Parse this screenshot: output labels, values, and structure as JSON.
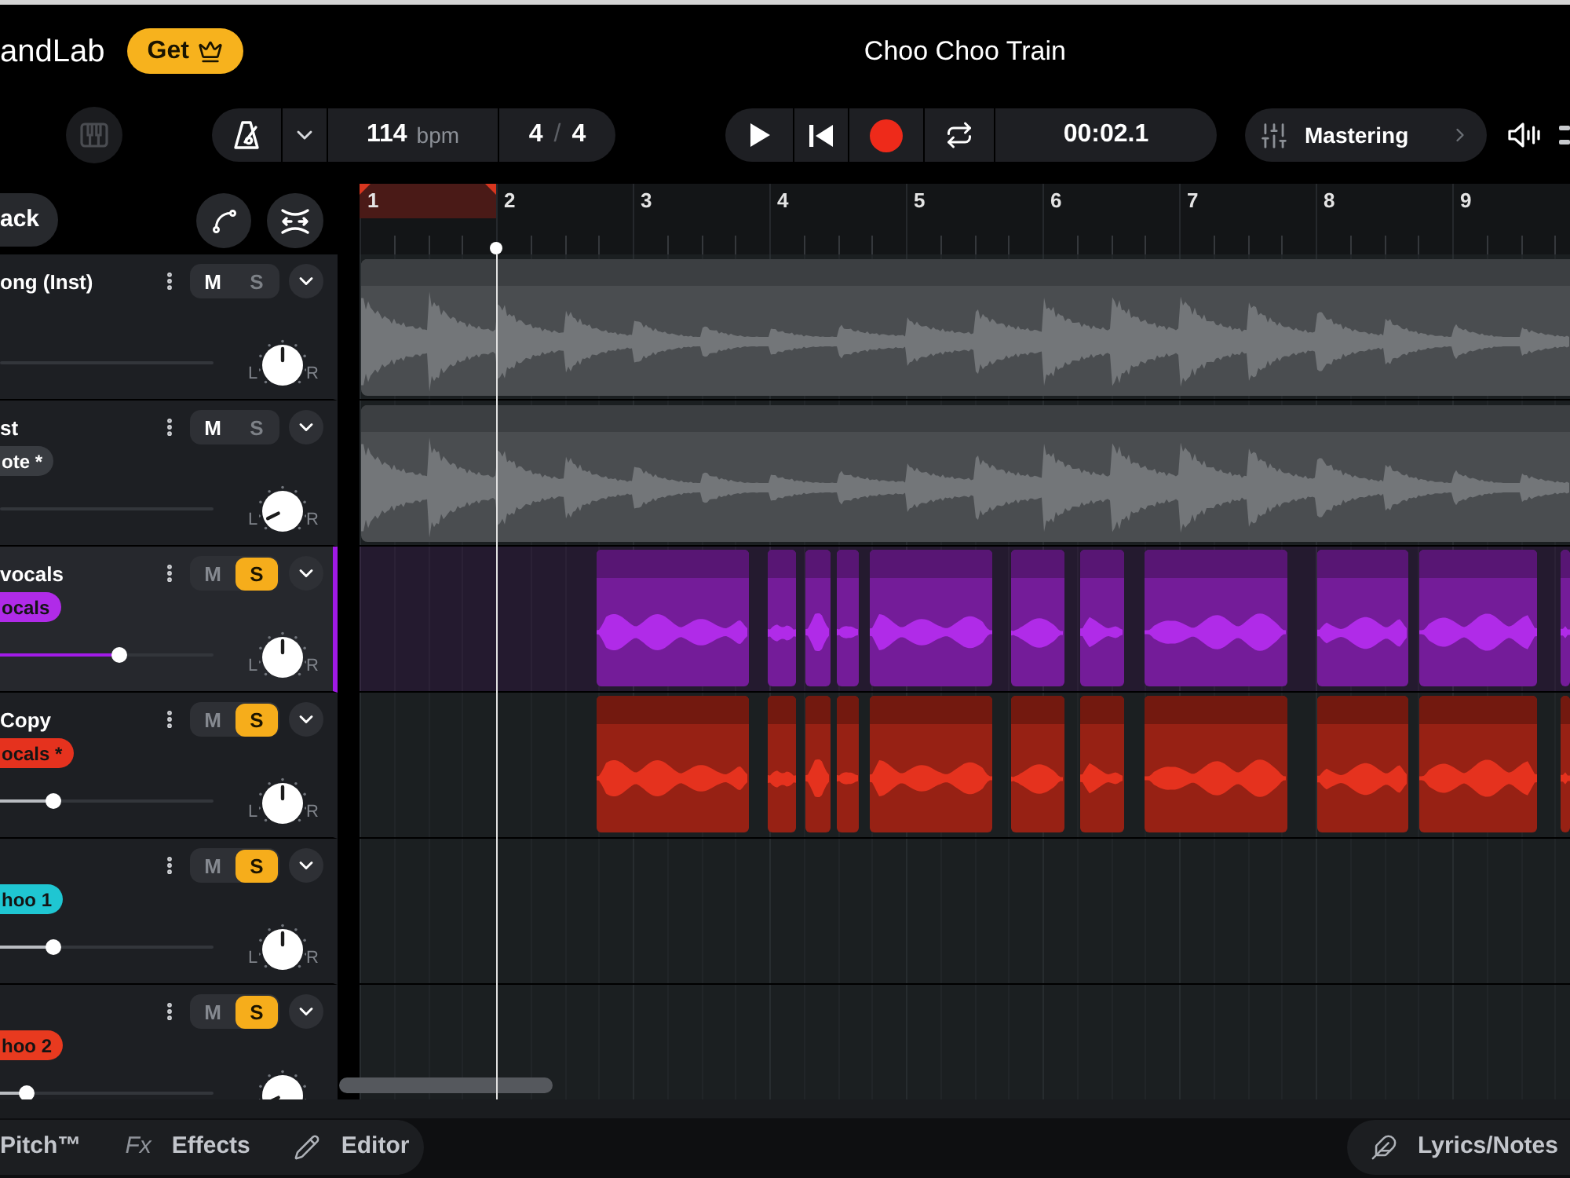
{
  "app": {
    "logo": "andLab",
    "get_button": "Get",
    "title": "Choo Choo Train"
  },
  "toolbar": {
    "tempo": {
      "value": "114",
      "unit": "bpm"
    },
    "time_signature": {
      "beats": "4",
      "separator": "/",
      "unit": "4"
    },
    "time": "00:02.1",
    "mastering": "Mastering"
  },
  "track_panel": {
    "add_button": "ack"
  },
  "tracks": [
    {
      "name": "ong (Inst)",
      "selected": false,
      "mute": {
        "label": "M",
        "on": true
      },
      "solo": {
        "label": "S",
        "on": false
      },
      "pan": {
        "left": "L",
        "right": "R",
        "panned_left": false
      },
      "clips": {
        "kind": "full"
      }
    },
    {
      "name": "st",
      "tag": {
        "text": "ote *",
        "color": "#393c41"
      },
      "selected": false,
      "mute": {
        "label": "M",
        "on": true
      },
      "solo": {
        "label": "S",
        "on": false
      },
      "pan": {
        "left": "L",
        "right": "R",
        "panned_left": true
      },
      "clips": {
        "kind": "full"
      }
    },
    {
      "name": "vocals",
      "tag": {
        "text": "ocals",
        "color": "#b02be8"
      },
      "selected": true,
      "mute": {
        "label": "M",
        "on": false
      },
      "solo": {
        "label": "S",
        "on": true
      },
      "volume": {
        "level": 0.56
      },
      "pan": {
        "left": "L",
        "right": "R",
        "panned_left": false
      },
      "clips": {
        "kind": "phrases"
      }
    },
    {
      "name": "Copy",
      "tag": {
        "text": "ocals *",
        "color": "#e5321e"
      },
      "selected": false,
      "mute": {
        "label": "M",
        "on": false
      },
      "solo": {
        "label": "S",
        "on": true
      },
      "volume": {
        "level": 0.25
      },
      "pan": {
        "left": "L",
        "right": "R",
        "panned_left": false
      },
      "clips": {
        "kind": "phrases"
      }
    },
    {
      "tag": {
        "text": "hoo 1",
        "color": "#1fc6d2"
      },
      "selected": false,
      "mute": {
        "label": "M",
        "on": false
      },
      "solo": {
        "label": "S",
        "on": true
      },
      "volume": {
        "level": 0.25
      },
      "pan": {
        "left": "L",
        "right": "R",
        "panned_left": false
      },
      "clips": {
        "kind": "empty"
      }
    },
    {
      "tag": {
        "text": "hoo 2",
        "color": "#e83a1f"
      },
      "selected": false,
      "mute": {
        "label": "M",
        "on": false
      },
      "solo": {
        "label": "S",
        "on": true
      },
      "volume": {
        "level": 0.125
      },
      "pan": {
        "panned_left": true
      },
      "clips": {
        "kind": "empty"
      }
    }
  ],
  "ruler": {
    "bars": [
      "1",
      "2",
      "3",
      "4",
      "5",
      "6",
      "7",
      "8",
      "9"
    ]
  },
  "bottom_bar": {
    "tools": [
      {
        "kind": "plain",
        "label": "Pitch™"
      },
      {
        "kind": "prefixed",
        "prefix": "Fx",
        "label": "Effects"
      },
      {
        "kind": "pencil",
        "label": "Editor"
      }
    ],
    "lyrics_button": "Lyrics/Notes"
  }
}
